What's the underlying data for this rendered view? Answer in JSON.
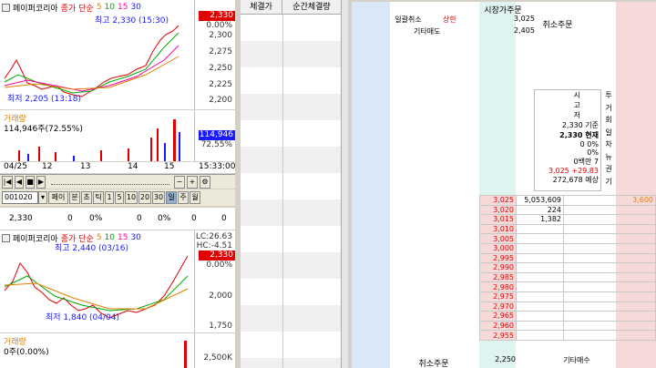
{
  "colors": {
    "up": "#e00000",
    "down": "#1a1aff",
    "ma5": "#e08000",
    "ma20": "#00aa00",
    "ma60": "#ff00aa",
    "bg_panel": "#d4d0c8",
    "ask_bg": "#d9e7f7",
    "bid_bg": "#f6dada"
  },
  "top_chart": {
    "name": "페이퍼코리아",
    "legend": [
      "종가",
      "단순",
      "5",
      "10",
      "15",
      "30"
    ],
    "high_label": "최고 2,330 (15:30)",
    "low_label": "최저 2,205 (13:18)",
    "price_badge": "2,330",
    "pct_badge": "0.00%",
    "ticks": [
      "2,300",
      "2,275",
      "2,250",
      "2,225",
      "2,200"
    ],
    "volume_title": "거래량",
    "volume_value": "114,946주(72.55%)",
    "volume_badge": "114,946",
    "volume_pct": "72.55%",
    "time_axis": [
      "04/25",
      "12",
      "13",
      "14",
      "15",
      "15:33:00"
    ]
  },
  "toolbar": {
    "code": "001020",
    "buttons": [
      "페이",
      "분",
      "초",
      "틱",
      "1",
      "5",
      "10",
      "20",
      "30",
      "일",
      "주",
      "월"
    ]
  },
  "ticker_row": {
    "price": "2,330",
    "change": "0",
    "rate": "0%",
    "v1": "0",
    "v2": "0%",
    "v3": "0",
    "v4": "0"
  },
  "bottom_chart": {
    "name": "페이퍼코리아",
    "legend": [
      "종가",
      "단순",
      "5",
      "10",
      "15",
      "30"
    ],
    "high_label": "최고 2,440 (03/16)",
    "low_label": "최저 1,840 (04/04)",
    "lc": "LC:26.63",
    "hc": "HC:-4.51",
    "price_badge": "2,330",
    "pct_badge": "0.00%",
    "ticks": [
      "2,000",
      "1,750"
    ],
    "volume_title": "거래량",
    "volume_value": "0주(0.00%)",
    "volume_tick": "2,500K"
  },
  "trades": {
    "headers": [
      "체결가",
      "순간체결량"
    ]
  },
  "orderbook": {
    "header": "시장가주문",
    "row1": {
      "label": "일괄취소",
      "limit": "상한",
      "price": "3,025"
    },
    "row2": {
      "label": "기타매도",
      "price": "2,405"
    },
    "cancel_label": "취소주문",
    "info_labels": [
      "시",
      "고",
      "저"
    ],
    "info": [
      {
        "v": "2,330",
        "l": "기준"
      },
      {
        "v": "2,330",
        "l": "현재"
      },
      {
        "v": "0",
        "l": "0%"
      },
      {
        "v": "",
        "l": "0%"
      },
      {
        "v": "0백만",
        "l": "7"
      }
    ],
    "info_upper": "3,025 +29.83",
    "info_expected": "272,678 예상",
    "side_tabs": [
      "투",
      "거",
      "회",
      "일",
      "차",
      "뉴",
      "권",
      "기"
    ],
    "asks": [
      {
        "price": "3,025",
        "qty": "5,053,609",
        "extra": "3,600"
      },
      {
        "price": "3,020",
        "qty": "224",
        "extra": ""
      },
      {
        "price": "3,015",
        "qty": "1,382",
        "extra": ""
      },
      {
        "price": "3,010",
        "qty": "",
        "extra": ""
      },
      {
        "price": "3,005",
        "qty": "",
        "extra": ""
      },
      {
        "price": "3,000",
        "qty": "",
        "extra": ""
      },
      {
        "price": "2,995",
        "qty": "",
        "extra": ""
      },
      {
        "price": "2,990",
        "qty": "",
        "extra": ""
      },
      {
        "price": "2,985",
        "qty": "",
        "extra": ""
      },
      {
        "price": "2,980",
        "qty": "",
        "extra": ""
      },
      {
        "price": "2,975",
        "qty": "",
        "extra": ""
      },
      {
        "price": "2,970",
        "qty": "",
        "extra": ""
      },
      {
        "price": "2,965",
        "qty": "",
        "extra": ""
      },
      {
        "price": "2,960",
        "qty": "",
        "extra": ""
      },
      {
        "price": "2,955",
        "qty": "",
        "extra": ""
      }
    ],
    "bottom_cancel": "취소주문",
    "bottom_price": "2,250",
    "bottom_label": "기타매수"
  }
}
